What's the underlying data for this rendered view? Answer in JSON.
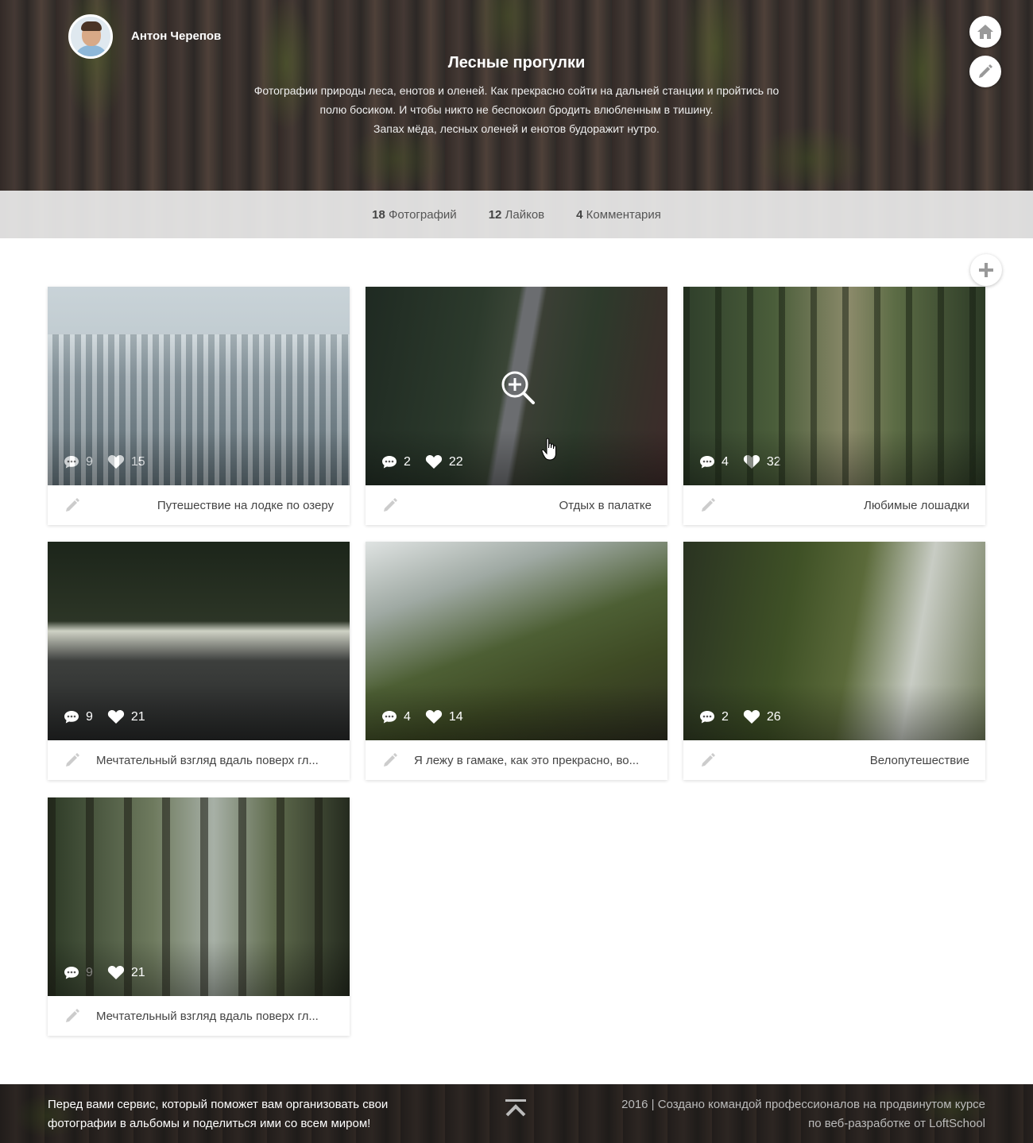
{
  "user": {
    "name": "Антон Черепов"
  },
  "album": {
    "title": "Лесные прогулки",
    "description_lines": [
      "Фотографии природы леса, енотов и оленей. Как прекрасно сойти на дальней станции и пройтись по",
      "полю босиком. И чтобы никто не беспокоил бродить влюбленным в тишину.",
      "Запах мёда, лесных оленей и енотов будоражит нутро."
    ]
  },
  "header_buttons": {
    "home_icon": "home-icon",
    "edit_icon": "pencil-icon"
  },
  "stats": [
    {
      "count": "18",
      "label": "Фотографий"
    },
    {
      "count": "12",
      "label": "Лайков"
    },
    {
      "count": "4",
      "label": "Комментария"
    }
  ],
  "add_button_icon": "plus-icon",
  "photos": [
    {
      "comments": "9",
      "likes": "15",
      "caption": "Путешествие на лодке по озеру",
      "align": "right"
    },
    {
      "comments": "2",
      "likes": "22",
      "caption": "Отдых в палатке",
      "align": "right"
    },
    {
      "comments": "4",
      "likes": "32",
      "caption": "Любимые лошадки",
      "align": "right"
    },
    {
      "comments": "9",
      "likes": "21",
      "caption": "Мечтательный взгляд вдаль поверх гл...",
      "align": "left"
    },
    {
      "comments": "4",
      "likes": "14",
      "caption": "Я лежу в гамаке, как это прекрасно, во...",
      "align": "left"
    },
    {
      "comments": "2",
      "likes": "26",
      "caption": "Велопутешествие",
      "align": "right"
    },
    {
      "comments": "9",
      "likes": "21",
      "caption": "Мечтательный взгляд вдаль поверх гл...",
      "align": "left"
    }
  ],
  "footer": {
    "left_lines": [
      "Перед вами сервис, который поможет вам организовать свои",
      "фотографии в альбомы и поделиться ими со всем миром!"
    ],
    "right_lines": [
      "2016 | Создано командой профессионалов на продвинутом курсе",
      "по веб-разработке от LoftSchool"
    ]
  },
  "colors": {
    "stats_bar": "#ebebeb",
    "card_bg": "#ffffff",
    "pencil": "#cccccc",
    "icon_gray": "#999999"
  }
}
